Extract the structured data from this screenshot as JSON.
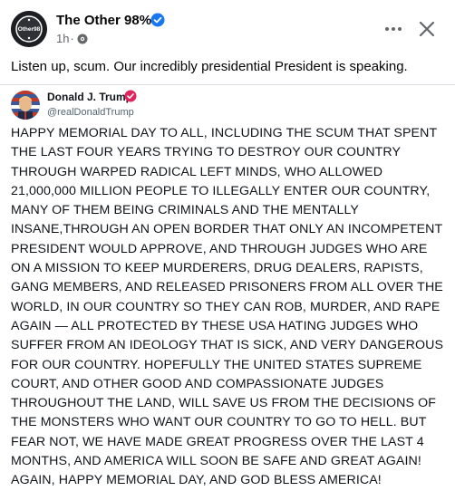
{
  "post": {
    "page_name": "The Other 98%",
    "time": "1h",
    "separator": "·",
    "caption": "Listen up, scum. Our incredibly presidential President is speaking.",
    "icons": {
      "avatar": "the-other-98-logo",
      "verified": "verified-badge-icon",
      "audience": "globe-icon",
      "more": "more-options-icon",
      "close": "close-icon"
    },
    "colors": {
      "verified": "#1877f2",
      "meta": "#65676b"
    }
  },
  "embedded_post": {
    "author_name": "Donald J. Trump",
    "author_handle": "@realDonaldTrump",
    "verified_color": "#e0245e",
    "text": "HAPPY MEMORIAL DAY TO ALL, INCLUDING THE SCUM THAT SPENT THE LAST FOUR YEARS TRYING TO DESTROY OUR COUNTRY THROUGH WARPED RADICAL LEFT MINDS, WHO ALLOWED 21,000,000 MILLION PEOPLE TO ILLEGALLY ENTER OUR COUNTRY, MANY OF THEM BEING CRIMINALS AND THE MENTALLY INSANE,THROUGH AN OPEN BORDER THAT ONLY AN INCOMPETENT PRESIDENT WOULD APPROVE, AND THROUGH JUDGES WHO ARE ON A MISSION TO KEEP MURDERERS, DRUG DEALERS, RAPISTS, GANG MEMBERS, AND RELEASED PRISONERS FROM ALL OVER THE WORLD, IN OUR COUNTRY SO THEY CAN ROB, MURDER, AND RAPE AGAIN — ALL PROTECTED BY THESE USA HATING JUDGES WHO SUFFER FROM AN IDEOLOGY THAT IS SICK, AND VERY DANGEROUS FOR OUR COUNTRY. HOPEFULLY THE UNITED STATES SUPREME COURT, AND OTHER GOOD AND COMPASSIONATE JUDGES THROUGHOUT THE LAND, WILL SAVE US FROM THE DECISIONS OF THE MONSTERS WHO WANT OUR COUNTRY TO GO TO HELL. BUT FEAR NOT, WE HAVE MADE GREAT PROGRESS OVER THE LAST 4 MONTHS, AND AMERICA WILL SOON BE SAFE AND GREAT AGAIN! AGAIN, HAPPY MEMORIAL DAY, AND GOD BLESS AMERICA!"
  }
}
